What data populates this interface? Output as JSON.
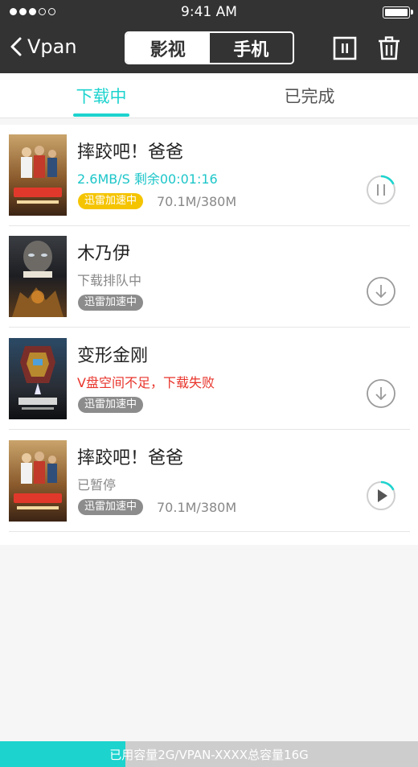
{
  "status_bar": {
    "time": "9:41 AM",
    "signal_dots_filled": 3,
    "signal_dots_total": 5
  },
  "nav": {
    "back_label": "Vpan",
    "segments": [
      {
        "label": "影视",
        "active": true
      },
      {
        "label": "手机",
        "active": false
      }
    ],
    "right_icons": [
      "pause-all-icon",
      "trash-icon"
    ]
  },
  "tabs": [
    {
      "label": "下载中",
      "active": true
    },
    {
      "label": "已完成",
      "active": false
    }
  ],
  "items": [
    {
      "title": "摔跤吧！爸爸",
      "status": "2.6MB/S 剩余00:01:16",
      "status_type": "speed",
      "badge": "迅雷加速中",
      "badge_active": true,
      "size": "70.1M/380M",
      "action_icon": "pause-icon",
      "progress": 0.18
    },
    {
      "title": "木乃伊",
      "status": "下载排队中",
      "status_type": "queued",
      "badge": "迅雷加速中",
      "badge_active": false,
      "size": "",
      "action_icon": "download-icon"
    },
    {
      "title": "变形金刚",
      "status": "V盘空间不足，下载失败",
      "status_type": "error",
      "badge": "迅雷加速中",
      "badge_active": false,
      "size": "",
      "action_icon": "download-icon"
    },
    {
      "title": "摔跤吧！爸爸",
      "status": "已暂停",
      "status_type": "paused",
      "badge": "迅雷加速中",
      "badge_active": false,
      "size": "70.1M/380M",
      "action_icon": "play-icon",
      "progress": 0.18
    }
  ],
  "footer": {
    "capacity_text": "已用容量2G/VPAN-XXXX总容量16G",
    "used_fraction": 0.3
  },
  "colors": {
    "accent": "#1dd3ce",
    "error": "#e8342b",
    "badge_active": "#f5c400",
    "topbar": "#333333"
  }
}
